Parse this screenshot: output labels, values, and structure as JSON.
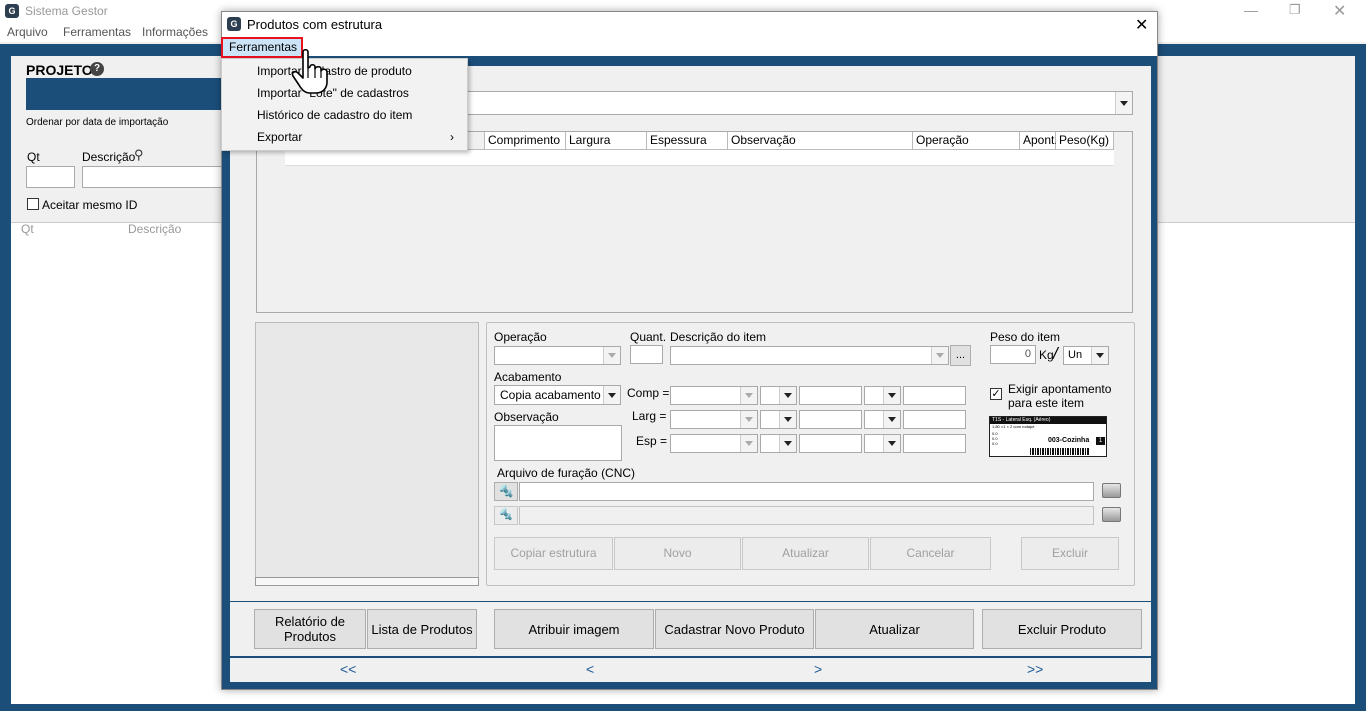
{
  "main_window": {
    "title": "Sistema Gestor",
    "menu": [
      "Arquivo",
      "Ferramentas",
      "Informações"
    ]
  },
  "left_panel": {
    "projeto_label": "PROJETO",
    "order_label": "Ordenar por data de importação",
    "qt_label": "Qt",
    "descricao_label": "Descrição",
    "checkbox_label": "Aceitar mesmo ID",
    "col_qt": "Qt",
    "col_descricao": "Descrição"
  },
  "dialog": {
    "title": "Produtos com estrutura",
    "menu_label": "Ferramentas",
    "dropdown": [
      "Importar cadastro de produto",
      "Importar \"Lote\" de cadastros",
      "Histórico de cadastro do item",
      "Exportar"
    ]
  },
  "grid": {
    "columns": [
      "Comprimento",
      "Largura",
      "Espessura",
      "Observação",
      "Operação",
      "Apont.",
      "Peso(Kg)"
    ]
  },
  "form": {
    "operacao_label": "Operação",
    "quant_label": "Quant.",
    "descricao_item_label": "Descrição do item",
    "browse_label": "...",
    "peso_label": "Peso do item",
    "peso_value": "0",
    "kg_label": "Kg",
    "slash": "/",
    "unit_value": "Un",
    "acabamento_label": "Acabamento",
    "acabamento_value": "Copia acabamento",
    "comp_label": "Comp =",
    "larg_label": "Larg =",
    "esp_label": "Esp =",
    "observacao_label": "Observação",
    "exigir_label": "Exigir apontamento",
    "exigir_label2": "para este item",
    "cnc_label": "Arquivo de furação (CNC)"
  },
  "label_preview": {
    "header": "T1S - Lateral Esq. (Aéreo)",
    "sub": "1.80 ×1 × 2 com rodapé",
    "r1": "0.0",
    "r2": "0.0",
    "r3": "0.0",
    "code": "003-Cozinha",
    "num": "1"
  },
  "actions": [
    "Copiar estrutura",
    "Novo",
    "Atualizar",
    "Cancelar",
    "Excluir"
  ],
  "bottom_buttons": [
    "Relatório de Produtos",
    "Lista de Produtos",
    "Atribuir imagem",
    "Cadastrar Novo Produto",
    "Atualizar",
    "Excluir Produto"
  ],
  "nav": [
    "<<",
    "<",
    ">",
    ">>"
  ],
  "colors": {
    "frame": "#1b4f7a",
    "highlight": "#cce4f7",
    "red_outline": "#e8111d"
  }
}
